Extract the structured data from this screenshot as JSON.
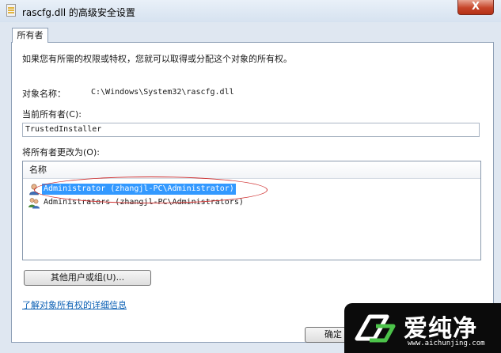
{
  "window": {
    "title": "rascfg.dll 的高级安全设置",
    "close_label": "X"
  },
  "tabs": [
    {
      "label": "所有者"
    }
  ],
  "owner": {
    "intro": "如果您有所需的权限或特权，您就可以取得或分配这个对象的所有权。",
    "object_name_label": "对象名称：",
    "object_name_value": "C:\\Windows\\System32\\rascfg.dll",
    "current_owner_label": "当前所有者(C):",
    "current_owner_value": "TrustedInstaller",
    "change_owner_label": "将所有者更改为(O):",
    "list_header": "名称",
    "list_items": [
      {
        "label": "Administrator (zhangjl-PC\\Administrator)",
        "selected": true
      },
      {
        "label": "Administrators (zhangjl-PC\\Administrators)",
        "selected": false
      }
    ],
    "other_users_button": "其他用户或组(U)...",
    "learn_more_link": "了解对象所有权的详细信息",
    "ok_button": "确定"
  },
  "watermark": {
    "text": "爱纯净",
    "url": "www.aichunjing.com"
  },
  "colors": {
    "selection": "#3399ff",
    "link": "#0a5fb4",
    "annotation": "#d03030"
  }
}
